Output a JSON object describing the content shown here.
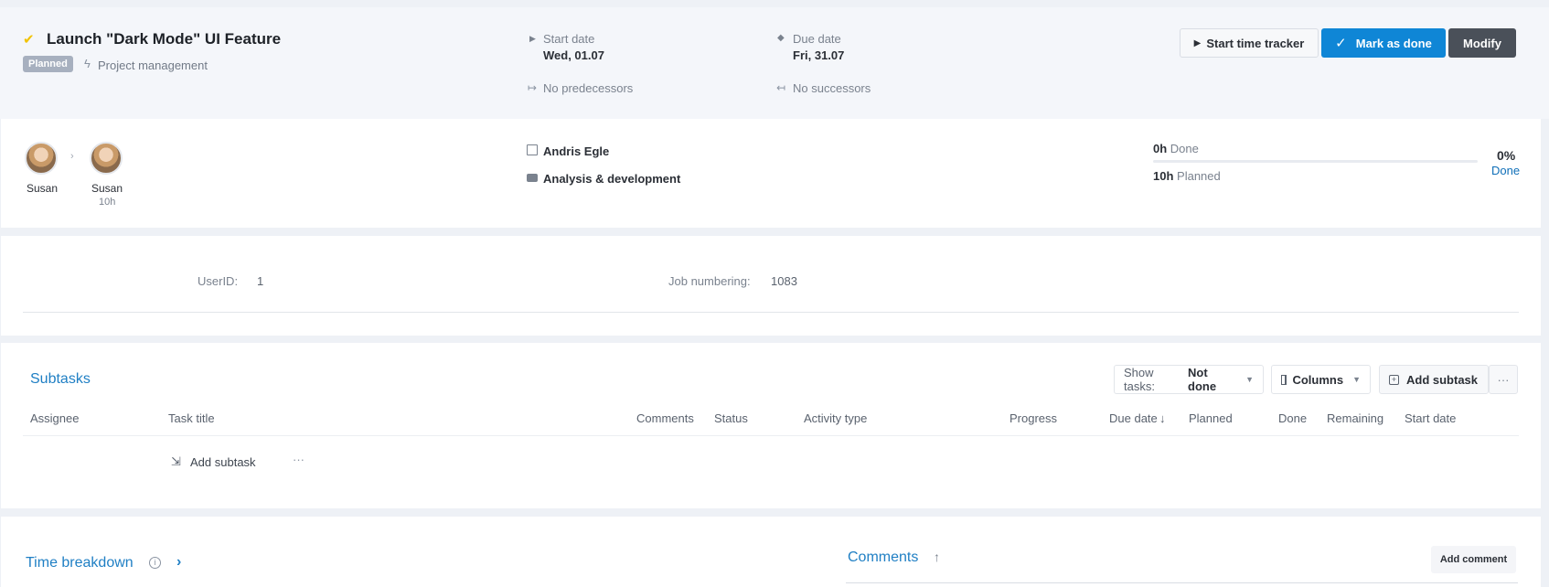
{
  "task": {
    "title": "Launch \"Dark Mode\" UI Feature",
    "status_badge": "Planned",
    "project": "Project management",
    "start_label": "Start date",
    "start_value": "Wed, 01.07",
    "due_label": "Due date",
    "due_value": "Fri, 31.07",
    "predecessors": "No predecessors",
    "successors": "No successors"
  },
  "actions": {
    "tracker_label": "Start time tracker",
    "done_label": "Mark as done",
    "modify_label": "Modify"
  },
  "assignees": {
    "from_name": "Susan",
    "to_name": "Susan",
    "to_hours": "10h"
  },
  "details": {
    "owner": "Andris Egle",
    "department": "Analysis & development"
  },
  "progress": {
    "done_hours": "0h",
    "done_label": "Done",
    "planned_hours": "10h",
    "planned_label": "Planned",
    "percent_text": "0%",
    "percent_caption": "Done",
    "fraction": 0
  },
  "fields": {
    "userid_label": "UserID:",
    "userid_value": "1",
    "job_label": "Job numbering:",
    "job_value": "1083"
  },
  "subtasks": {
    "title": "Subtasks",
    "show_prefix": "Show tasks:",
    "show_value": "Not done",
    "columns_label": "Columns",
    "add_label": "Add subtask",
    "more": "···",
    "headers": [
      "Assignee",
      "Task title",
      "Comments",
      "Status",
      "Activity type",
      "Progress",
      "Due date",
      "Planned",
      "Done",
      "Remaining",
      "Start date"
    ],
    "sort_arrow": "↓",
    "add_row_label": "Add subtask",
    "add_row_more": "···"
  },
  "bottom": {
    "time_title": "Time breakdown",
    "comments_title": "Comments",
    "comments_sort": "↑",
    "add_comment": "Add comment"
  },
  "icons": {
    "check": "check-icon",
    "bolt": "bolt-icon",
    "play": "play-icon",
    "diamond": "diamond-icon",
    "predecessor": "arrow-right-bar-icon",
    "successor": "arrow-left-bar-icon",
    "building": "building-icon",
    "briefcase": "briefcase-icon",
    "columns": "columns-icon",
    "plus": "plus-square-icon",
    "info": "info-icon",
    "chevron": "chevron-right-icon"
  },
  "colors": {
    "accent": "#0f86d6",
    "link": "#1f7fc4",
    "badge": "#a7b0bf",
    "modify": "#4a5059",
    "check": "#f2c300"
  }
}
